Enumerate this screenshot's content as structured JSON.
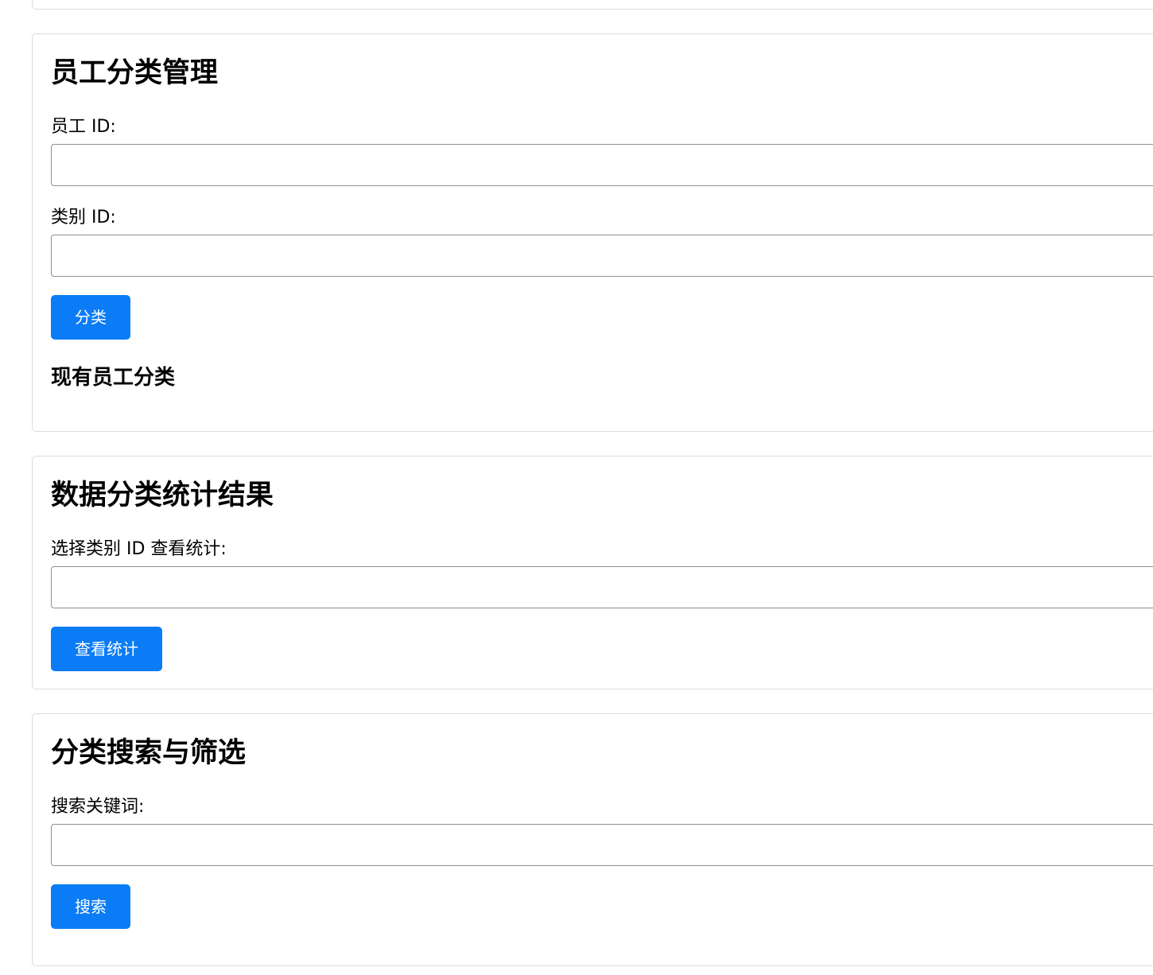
{
  "employee_classification": {
    "title": "员工分类管理",
    "employee_id_label": "员工 ID:",
    "employee_id_value": "",
    "category_id_label": "类别 ID:",
    "category_id_value": "",
    "classify_button": "分类",
    "existing_title": "现有员工分类"
  },
  "stats": {
    "title": "数据分类统计结果",
    "select_label": "选择类别 ID 查看统计:",
    "select_value": "",
    "view_button": "查看统计"
  },
  "search": {
    "title": "分类搜索与筛选",
    "keyword_label": "搜索关键词:",
    "keyword_value": "",
    "search_button": "搜索"
  },
  "colors": {
    "button_bg": "#0b7cf5",
    "card_border": "#dcdcdc",
    "input_border": "#8f8f8f"
  }
}
